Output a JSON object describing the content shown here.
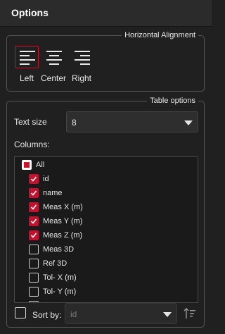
{
  "header": {
    "title": "Options"
  },
  "alignment": {
    "legend": "Horizontal Alignment",
    "buttons": [
      {
        "label": "Left",
        "icon": "align-left-icon",
        "selected": true
      },
      {
        "label": "Center",
        "icon": "align-center-icon",
        "selected": false
      },
      {
        "label": "Right",
        "icon": "align-right-icon",
        "selected": false
      }
    ]
  },
  "table_options": {
    "legend": "Table options",
    "text_size_label": "Text size",
    "text_size_value": "8",
    "columns_label": "Columns:",
    "columns": [
      {
        "label": "All",
        "state": "partial"
      },
      {
        "label": "id",
        "state": "checked"
      },
      {
        "label": "name",
        "state": "checked"
      },
      {
        "label": "Meas X (m)",
        "state": "checked"
      },
      {
        "label": "Meas Y (m)",
        "state": "checked"
      },
      {
        "label": "Meas Z (m)",
        "state": "checked"
      },
      {
        "label": "Meas 3D",
        "state": "unchecked"
      },
      {
        "label": "Ref 3D",
        "state": "unchecked"
      },
      {
        "label": "Tol- X (m)",
        "state": "unchecked"
      },
      {
        "label": "Tol- Y (m)",
        "state": "unchecked"
      },
      {
        "label": "Tol- Z (m)",
        "state": "unchecked"
      }
    ],
    "sort_by_label": "Sort by:",
    "sort_by_value": "id",
    "sort_by_checked": false
  },
  "colors": {
    "accent": "#c8102e",
    "background": "#202020",
    "header": "#2b2b2b"
  }
}
